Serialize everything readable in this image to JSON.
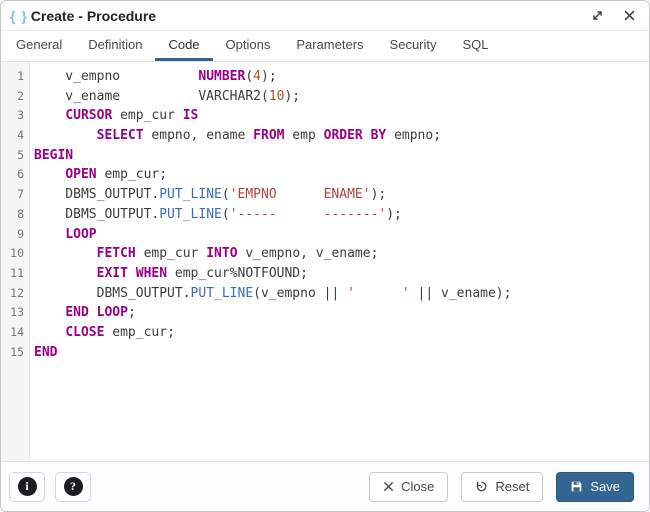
{
  "window": {
    "title": "Create - Procedure",
    "title_icon": "braces-icon",
    "title_icon_glyph": "{ }",
    "controls": [
      "maximize-icon",
      "close-icon"
    ]
  },
  "tabs": {
    "items": [
      "General",
      "Definition",
      "Code",
      "Options",
      "Parameters",
      "Security",
      "SQL"
    ],
    "active": "Code"
  },
  "editor": {
    "line_count": 15,
    "lines": [
      [
        [
          "",
          "    v_empno          "
        ],
        [
          "kw",
          "NUMBER"
        ],
        [
          "",
          "("
        ],
        [
          "num",
          "4"
        ],
        [
          "",
          ");"
        ]
      ],
      [
        [
          "",
          "    v_ename          VARCHAR2("
        ],
        [
          "num",
          "10"
        ],
        [
          "",
          ");"
        ]
      ],
      [
        [
          "",
          "    "
        ],
        [
          "kw",
          "CURSOR"
        ],
        [
          "",
          " emp_cur "
        ],
        [
          "kw",
          "IS"
        ]
      ],
      [
        [
          "",
          "        "
        ],
        [
          "kw",
          "SELECT"
        ],
        [
          "",
          " empno, ename "
        ],
        [
          "kw",
          "FROM"
        ],
        [
          "",
          " emp "
        ],
        [
          "kw",
          "ORDER BY"
        ],
        [
          "",
          " empno;"
        ]
      ],
      [
        [
          "kw",
          "BEGIN"
        ]
      ],
      [
        [
          "",
          "    "
        ],
        [
          "kw",
          "OPEN"
        ],
        [
          "",
          " emp_cur;"
        ]
      ],
      [
        [
          "",
          "    DBMS_OUTPUT."
        ],
        [
          "fn",
          "PUT_LINE"
        ],
        [
          "",
          "("
        ],
        [
          "str",
          "'EMPNO      ENAME'"
        ],
        [
          "",
          ");"
        ]
      ],
      [
        [
          "",
          "    DBMS_OUTPUT."
        ],
        [
          "fn",
          "PUT_LINE"
        ],
        [
          "",
          "("
        ],
        [
          "str",
          "'-----      -------'"
        ],
        [
          "",
          ");"
        ]
      ],
      [
        [
          "",
          "    "
        ],
        [
          "kw",
          "LOOP"
        ]
      ],
      [
        [
          "",
          "        "
        ],
        [
          "kw",
          "FETCH"
        ],
        [
          "",
          " emp_cur "
        ],
        [
          "kw",
          "INTO"
        ],
        [
          "",
          " v_empno, v_ename;"
        ]
      ],
      [
        [
          "",
          "        "
        ],
        [
          "kw",
          "EXIT"
        ],
        [
          "",
          " "
        ],
        [
          "kw",
          "WHEN"
        ],
        [
          "",
          " emp_cur%NOTFOUND;"
        ]
      ],
      [
        [
          "",
          "        DBMS_OUTPUT."
        ],
        [
          "fn",
          "PUT_LINE"
        ],
        [
          "",
          "(v_empno || "
        ],
        [
          "str",
          "'      '"
        ],
        [
          "",
          " || v_ename);"
        ]
      ],
      [
        [
          "",
          "    "
        ],
        [
          "kw",
          "END LOOP"
        ],
        [
          "",
          ";"
        ]
      ],
      [
        [
          "",
          "    "
        ],
        [
          "kw",
          "CLOSE"
        ],
        [
          "",
          " emp_cur;"
        ]
      ],
      [
        [
          "kw",
          "END"
        ]
      ]
    ]
  },
  "footer": {
    "info_icon": "i",
    "help_icon": "?",
    "close_label": "Close",
    "reset_label": "Reset",
    "save_label": "Save"
  },
  "colors": {
    "accent": "#326690",
    "keyword": "#990088",
    "number": "#a8561e",
    "string": "#b0413e",
    "builtin": "#3b6bc0",
    "braces_icon": "#7dc2e5"
  }
}
